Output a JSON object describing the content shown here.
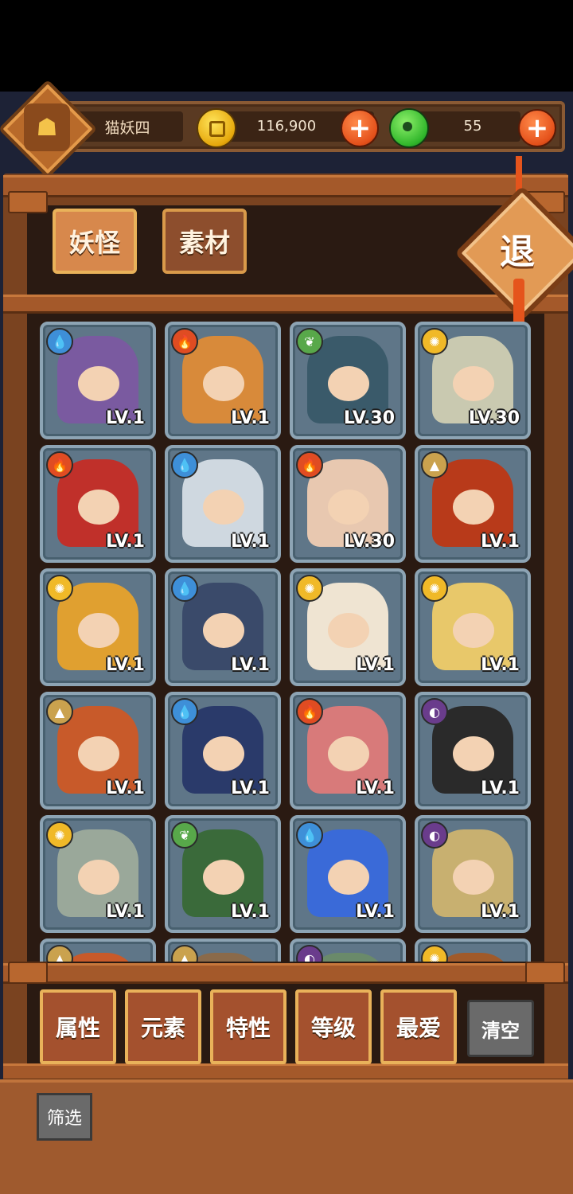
{
  "player": {
    "name": "猫妖四",
    "avatar_icon": "pagoda-emblem-icon"
  },
  "currency": {
    "coins": "116,900",
    "gems": "55",
    "coin_icon": "gold-coin-icon",
    "gem_icon": "jade-coin-icon",
    "plus_icon": "plus-icon"
  },
  "tabs": [
    {
      "label": "妖怪",
      "active": true
    },
    {
      "label": "素材",
      "active": false
    }
  ],
  "exit_label": "退",
  "monsters": [
    {
      "element": "water",
      "level": "LV.1",
      "color": "#7a5aa0"
    },
    {
      "element": "fire",
      "level": "LV.1",
      "color": "#d88a3a"
    },
    {
      "element": "wood",
      "level": "LV.30",
      "color": "#3a5a6a"
    },
    {
      "element": "light",
      "level": "LV.30",
      "color": "#c9c9b0"
    },
    {
      "element": "fire",
      "level": "LV.1",
      "color": "#c0302a"
    },
    {
      "element": "water",
      "level": "LV.1",
      "color": "#cfd8e0"
    },
    {
      "element": "fire",
      "level": "LV.30",
      "color": "#e8c8b0"
    },
    {
      "element": "earth",
      "level": "LV.1",
      "color": "#b83a1a"
    },
    {
      "element": "light",
      "level": "LV.1",
      "color": "#e0a030"
    },
    {
      "element": "water",
      "level": "LV.1",
      "color": "#3a4a6a"
    },
    {
      "element": "light",
      "level": "LV.1",
      "color": "#efe4d2"
    },
    {
      "element": "light",
      "level": "LV.1",
      "color": "#e8c86a"
    },
    {
      "element": "earth",
      "level": "LV.1",
      "color": "#c85a2a"
    },
    {
      "element": "water",
      "level": "LV.1",
      "color": "#2a3a6a"
    },
    {
      "element": "fire",
      "level": "LV.1",
      "color": "#d87a7a"
    },
    {
      "element": "dark",
      "level": "LV.1",
      "color": "#2a2a2a"
    },
    {
      "element": "light",
      "level": "LV.1",
      "color": "#9aa89a"
    },
    {
      "element": "wood",
      "level": "LV.1",
      "color": "#3a6a3a"
    },
    {
      "element": "water",
      "level": "LV.1",
      "color": "#3a6ad8"
    },
    {
      "element": "dark",
      "level": "LV.1",
      "color": "#c8b070"
    },
    {
      "element": "earth",
      "level": "",
      "color": "#c85a2a"
    },
    {
      "element": "earth",
      "level": "",
      "color": "#8a6a4a"
    },
    {
      "element": "dark",
      "level": "",
      "color": "#6a8a6a"
    },
    {
      "element": "light",
      "level": "",
      "color": "#a05a2a"
    }
  ],
  "filters": [
    "属性",
    "元素",
    "特性",
    "等级",
    "最爱"
  ],
  "clear_label": "清空",
  "filter_tag": "筛选"
}
